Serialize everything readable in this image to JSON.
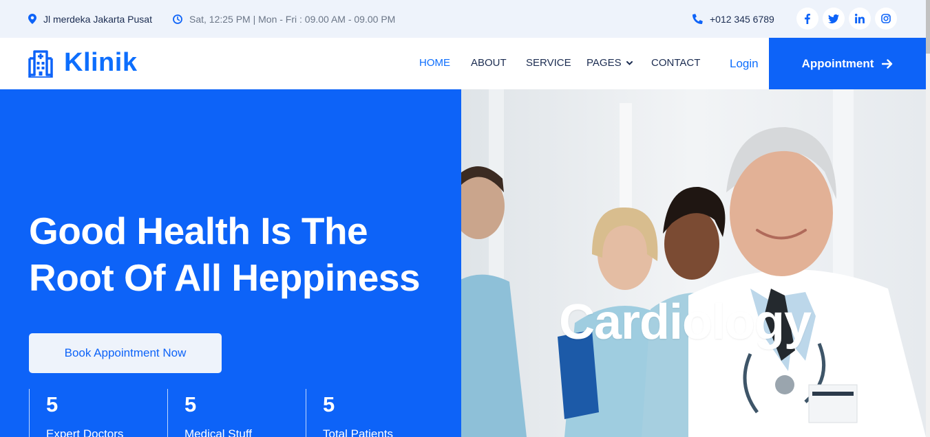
{
  "topbar": {
    "address": "Jl merdeka Jakarta Pusat",
    "hours": "Sat, 12:25 PM | Mon - Fri : 09.00 AM - 09.00 PM",
    "phone": "+012 345 6789",
    "socials": [
      "facebook-icon",
      "twitter-icon",
      "linkedin-icon",
      "instagram-icon"
    ],
    "icons": {
      "address": "map-pin-icon",
      "hours": "clock-icon",
      "phone": "phone-icon"
    }
  },
  "brand": {
    "name": "Klinik",
    "icon": "hospital-icon",
    "accent": "#0d63f8"
  },
  "nav": {
    "items": [
      {
        "label": "HOME",
        "active": true
      },
      {
        "label": "ABOUT"
      },
      {
        "label": "SERVICE"
      },
      {
        "label": "PAGES",
        "dropdown": true
      },
      {
        "label": "CONTACT"
      }
    ],
    "login": "Login",
    "appointment": "Appointment"
  },
  "hero": {
    "headline_line1": "Good Health Is The",
    "headline_line2": "Root Of All Heppiness",
    "cta": "Book Appointment Now",
    "stats": [
      {
        "value": "5",
        "label": "Expert Doctors"
      },
      {
        "value": "5",
        "label": "Medical Stuff"
      },
      {
        "value": "5",
        "label": "Total Patients"
      }
    ],
    "slide_caption": "Cardiology"
  }
}
